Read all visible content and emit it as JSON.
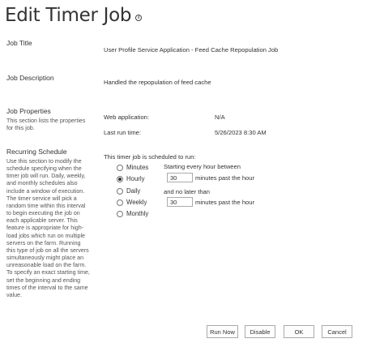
{
  "page": {
    "title": "Edit Timer Job",
    "info_icon": "info-circle-icon"
  },
  "job_title": {
    "label": "Job Title",
    "value": "User Profile Service Application - Feed Cache Repopulation Job"
  },
  "job_description": {
    "label": "Job Description",
    "value": "Handled the repopulation of feed cache"
  },
  "job_properties": {
    "label": "Job Properties",
    "description": "This section lists the properties for this job.",
    "web_application_label": "Web application:",
    "web_application_value": "N/A",
    "last_run_label": "Last run time:",
    "last_run_value": "5/26/2023 8:30 AM"
  },
  "recurring_schedule": {
    "label": "Recurring Schedule",
    "description": "Use this section to modify the schedule specifying when the timer job will run. Daily, weekly, and monthly schedules also include a window of execution. The timer service will pick a random time within this interval to begin executing the job on each applicable server. This feature is appropriate for high-load jobs which run on multiple servers on the farm. Running this type of job on all the servers simultaneously might place an unreasonable load on the farm. To specify an exact starting time, set the beginning and ending times of the interval to the same value.",
    "intro": "This timer job is scheduled to run:",
    "options": [
      "Minutes",
      "Hourly",
      "Daily",
      "Weekly",
      "Monthly"
    ],
    "selected": "Hourly",
    "starting_label": "Starting every hour between",
    "start_value": "30",
    "start_suffix": "minutes past the hour",
    "and_label": "and no later than",
    "end_value": "30",
    "end_suffix": "minutes past the hour"
  },
  "buttons": {
    "run_now": "Run Now",
    "disable": "Disable",
    "ok": "OK",
    "cancel": "Cancel"
  }
}
